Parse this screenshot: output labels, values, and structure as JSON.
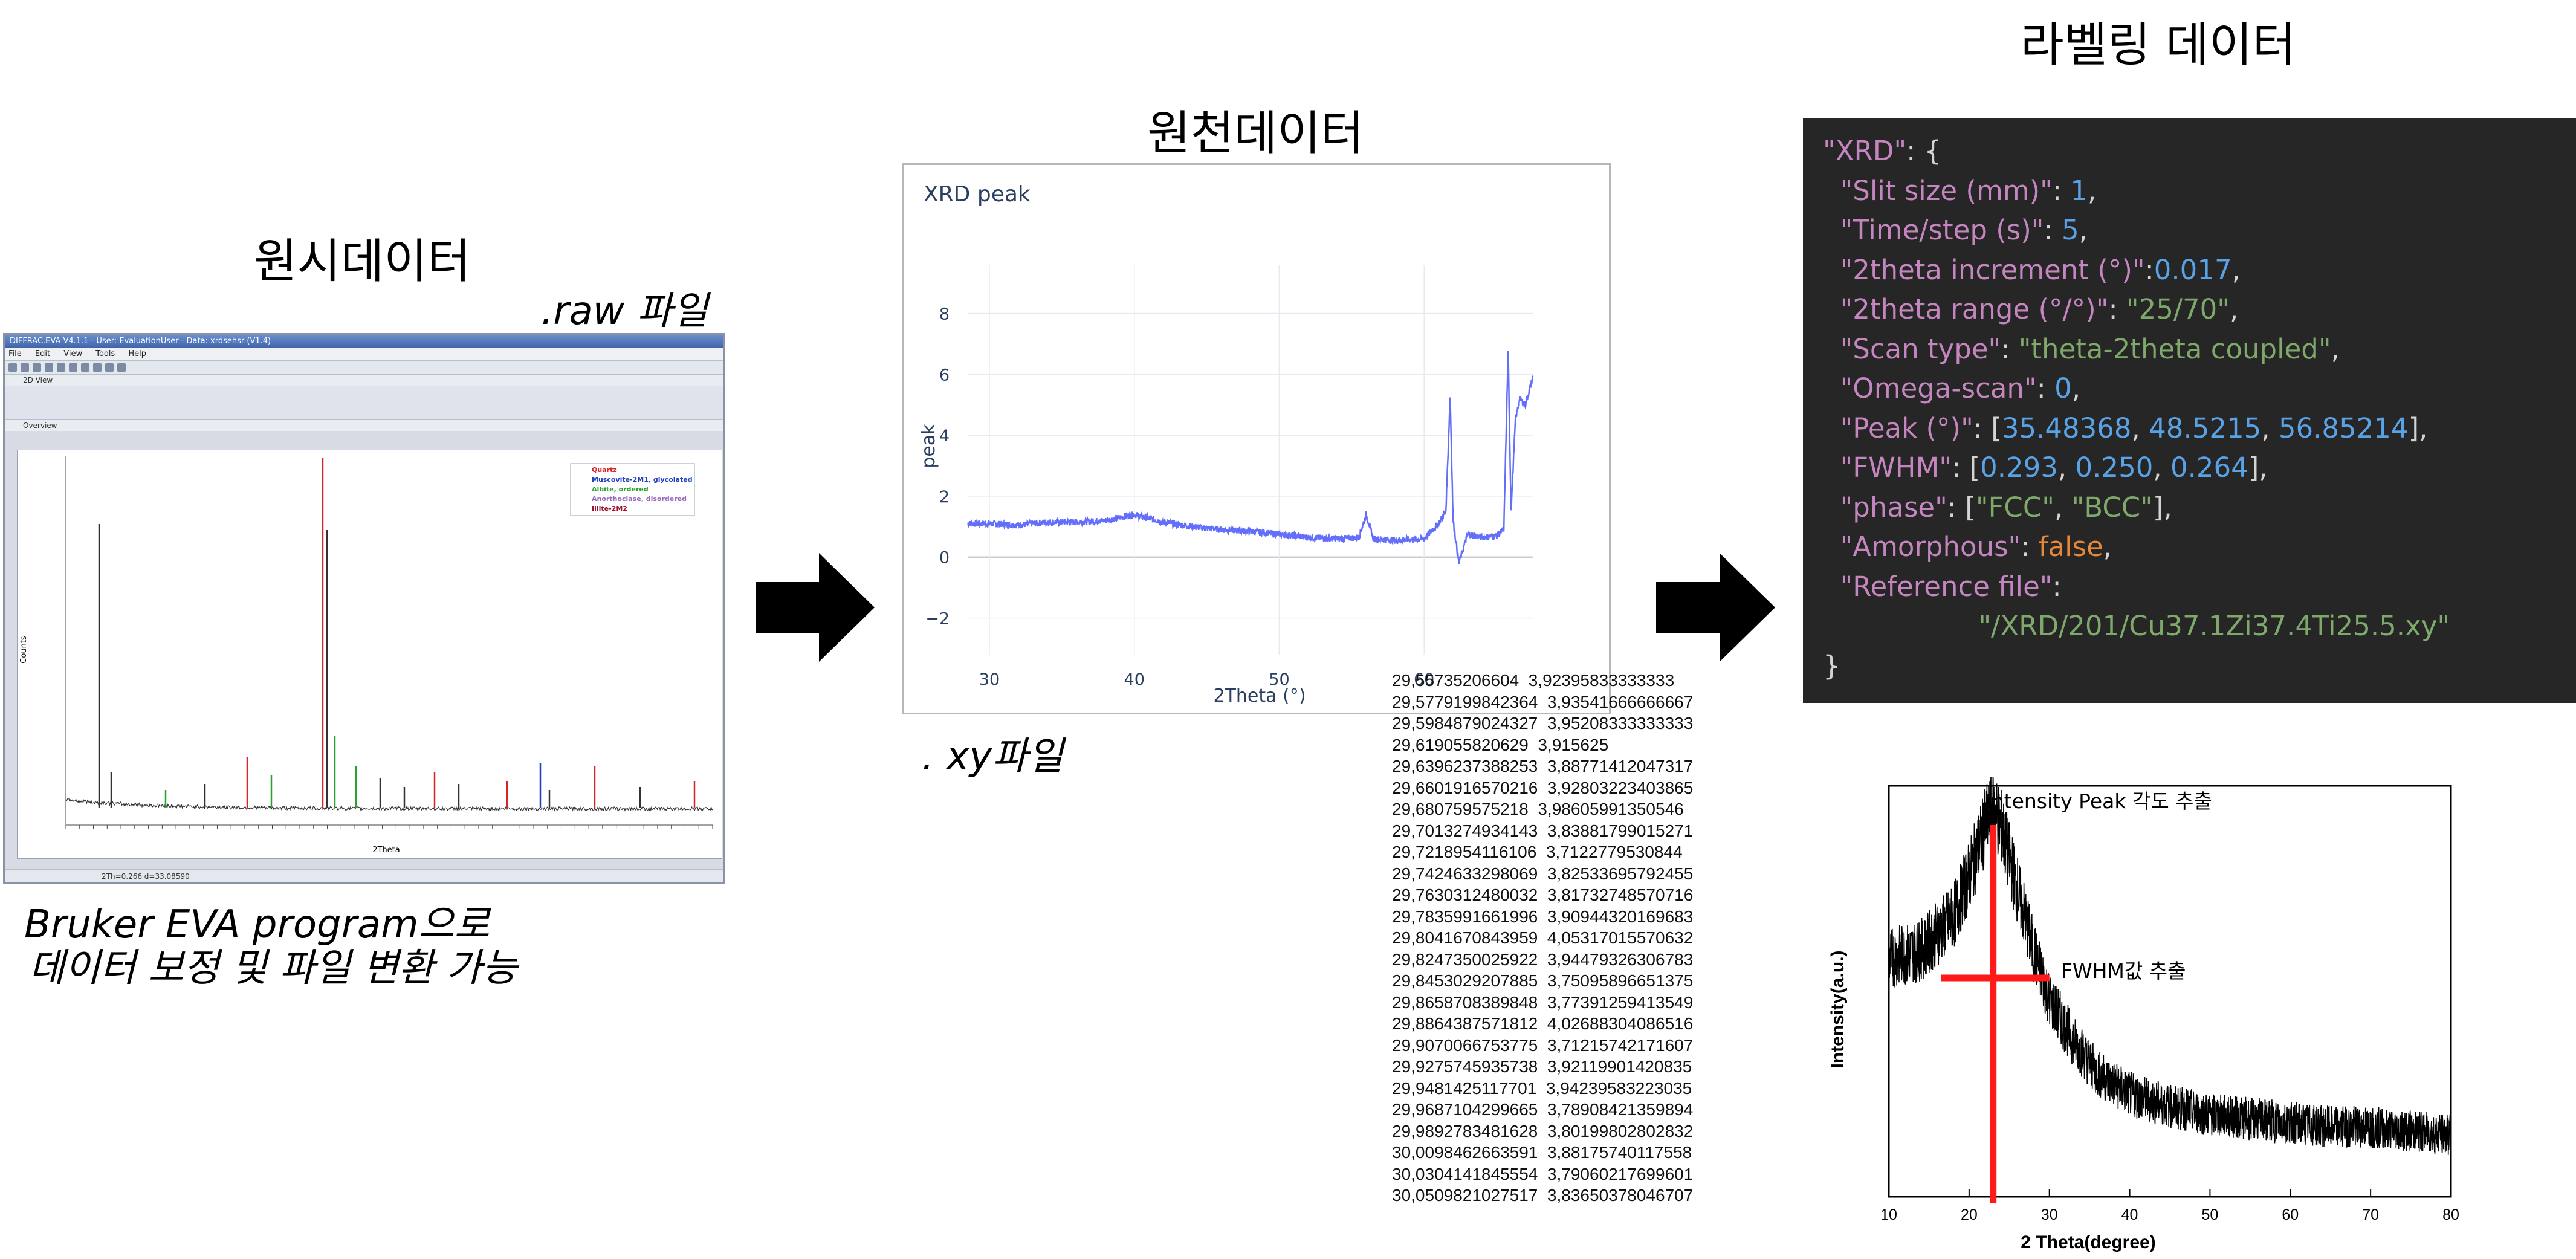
{
  "titles": {
    "raw_data": "원시데이터",
    "source_data": "원천데이터",
    "labeling_data": "라벨링 데이터"
  },
  "captions": {
    "raw_file": ".raw 파일",
    "xy_file": ". xy파일",
    "eva_note_line1": "Bruker EVA program으로",
    "eva_note_line2": "데이터 보정 및 파일 변환 가능"
  },
  "eva_window": {
    "title": "DIFFRAC.EVA V4.1.1 - User: EvaluationUser - Data: xrdsehsr (V1.4)",
    "menu": [
      "File",
      "Edit",
      "View",
      "Tools",
      "Help"
    ],
    "tab": "2D View",
    "subtab": "Overview",
    "legend": [
      {
        "label": "Quartz",
        "color": "#d62728"
      },
      {
        "label": "Muscovite-2M1, glycolated",
        "color": "#1f3fbf"
      },
      {
        "label": "Albite, ordered",
        "color": "#2ca02c"
      },
      {
        "label": "Anorthoclase, disordered",
        "color": "#9467bd"
      },
      {
        "label": "Illite-2M2",
        "color": "#a0102a"
      }
    ],
    "ylabel": "Counts",
    "xlabel": "2Theta",
    "status": "2Th=0.266  d=33.08590"
  },
  "xrd_chart": {
    "title": "XRD peak",
    "xlabel": "2Theta (°)",
    "ylabel": "peak",
    "xticks": [
      30,
      40,
      50,
      60
    ],
    "yticks": [
      -2,
      0,
      2,
      4,
      6,
      8
    ],
    "xlim": [
      28.5,
      67.5
    ],
    "ylim": [
      -3.2,
      9.2
    ],
    "color": "#636efa"
  },
  "xy_rows": [
    "29,55735206604  3,92395833333333",
    "29,5779199842364  3,93541666666667",
    "29,5984879024327  3,95208333333333",
    "29,619055820629  3,915625",
    "29,6396237388253  3,88771412047317",
    "29,6601916570216  3,92803223403865",
    "29,680759575218  3,98605991350546",
    "29,7013274934143  3,83881799015271",
    "29,7218954116106  3,7122779530844",
    "29,7424633298069  3,82533695792455",
    "29,7630312480032  3,81732748570716",
    "29,7835991661996  3,90944320169683",
    "29,8041670843959  4,05317015570632",
    "29,8247350025922  3,94479326306783",
    "29,8453029207885  3,75095896651375",
    "29,8658708389848  3,77391259413549",
    "29,8864387571812  4,02688304086516",
    "29,9070066753775  3,71215742171607",
    "29,9275745935738  3,92119901420835",
    "29,9481425117701  3,94239583223035",
    "29,9687104299665  3,78908421359894",
    "29,9892783481628  3,80199802802832",
    "30,0098462663591  3,88175740117558",
    "30,0304141845554  3,79060217699601",
    "30,0509821027517  3,83650378046707"
  ],
  "json_panel": {
    "root_key": "\"XRD\"",
    "root_open": ": {",
    "close": "}",
    "slit_key": "\"Slit size (mm)\"",
    "slit_val": "1",
    "time_key": "\"Time/step (s)\"",
    "time_val": "5",
    "incr_key": "\"2theta increment (°)\"",
    "incr_val": "0.017",
    "range_key": "\"2theta range (°/°)\"",
    "range_val": "\"25/70\"",
    "scan_key": "\"Scan type\"",
    "scan_val": "\"theta-2theta coupled\"",
    "omega_key": "\"Omega-scan\"",
    "omega_val": "0",
    "peak_key": "\"Peak (°)\"",
    "peak_vals": [
      "35.48368",
      "48.5215",
      "56.85214"
    ],
    "fwhm_key": "\"FWHM\"",
    "fwhm_vals": [
      "0.293",
      "0.250",
      "0.264"
    ],
    "phase_key": "\"phase\"",
    "phase_vals": [
      "\"FCC\"",
      "\"BCC\""
    ],
    "amorph_key": "\"Amorphous\"",
    "amorph_val": "false",
    "ref_key": "\"Reference file\"",
    "ref_val": "\"/XRD/201/Cu37.1Zi37.4Ti25.5.xy\""
  },
  "intensity_chart": {
    "xlabel": "2 Theta(degree)",
    "ylabel": "Intensity(a.u.)",
    "xticks": [
      10,
      20,
      30,
      40,
      50,
      60,
      70,
      80
    ],
    "xlim": [
      10,
      80
    ],
    "peak_annotation": "Intensity Peak 각도 추출",
    "fwhm_annotation": "FWHM값 추출",
    "peak_position": 23,
    "marker_color": "#ff1a1a"
  },
  "chart_data": [
    {
      "type": "line",
      "title": "XRD peak",
      "xlabel": "2Theta (°)",
      "ylabel": "peak",
      "xlim": [
        28.5,
        67.5
      ],
      "ylim": [
        -3.2,
        9.2
      ],
      "x": [
        28.5,
        30,
        32,
        34,
        36,
        38,
        40,
        42,
        44,
        46,
        48,
        50,
        52,
        54,
        55.5,
        56,
        56.5,
        58,
        60,
        61,
        61.5,
        61.8,
        62,
        62.4,
        63,
        64,
        65,
        65.5,
        65.8,
        66,
        66.3,
        66.6,
        67,
        67.5
      ],
      "series": [
        {
          "values": [
            1.1,
            1.1,
            1.05,
            1.15,
            1.15,
            1.2,
            1.4,
            1.15,
            1.0,
            0.9,
            0.85,
            0.75,
            0.65,
            0.6,
            0.65,
            1.4,
            0.6,
            0.55,
            0.6,
            1.1,
            1.5,
            5.3,
            1.2,
            -0.2,
            0.75,
            0.65,
            0.7,
            0.9,
            6.8,
            1.5,
            4.5,
            5.2,
            5.0,
            5.9
          ]
        }
      ]
    },
    {
      "type": "line",
      "xlabel": "2 Theta(degree)",
      "ylabel": "Intensity(a.u.)",
      "xlim": [
        10,
        80
      ],
      "x": [
        10,
        14,
        18,
        20,
        22,
        23,
        24,
        26,
        28,
        30,
        33,
        36,
        40,
        45,
        50,
        55,
        60,
        65,
        70,
        75,
        80
      ],
      "series": [
        {
          "values": [
            0.58,
            0.6,
            0.68,
            0.78,
            0.9,
            0.95,
            0.9,
            0.75,
            0.6,
            0.48,
            0.38,
            0.3,
            0.25,
            0.22,
            0.2,
            0.19,
            0.18,
            0.17,
            0.17,
            0.16,
            0.15
          ]
        }
      ]
    }
  ]
}
